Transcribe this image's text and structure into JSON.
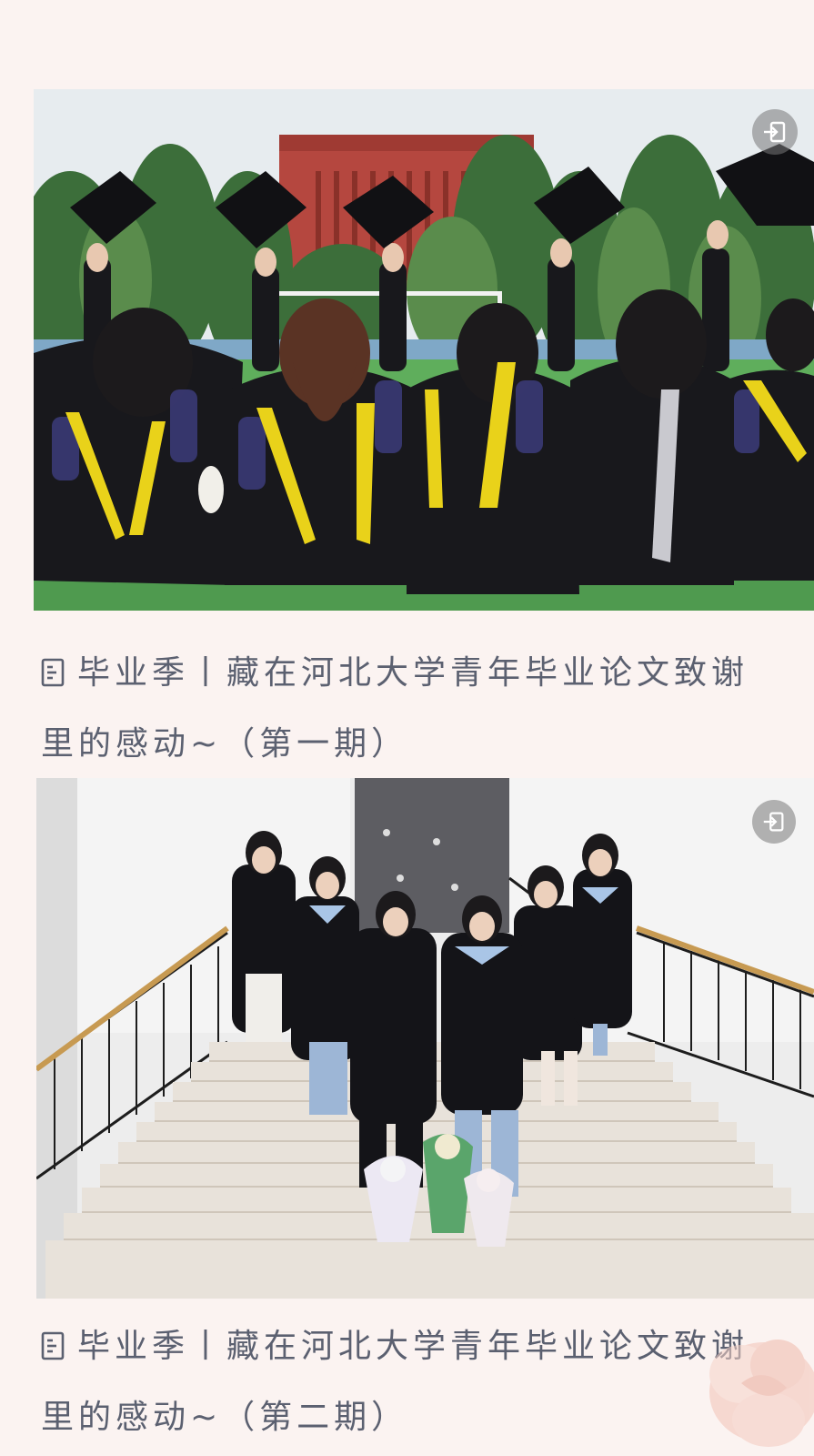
{
  "articles": [
    {
      "title_line1": "毕业季丨藏在河北大学青年毕业论文致谢",
      "title_line2": "里的感动~（第一期）",
      "image_icon": "share-icon",
      "doc_icon": "document-icon"
    },
    {
      "title_line1": "毕业季丨藏在河北大学青年毕业论文致谢",
      "title_line2": "里的感动~（第二期）",
      "image_icon": "share-icon",
      "doc_icon": "document-icon"
    }
  ],
  "colors": {
    "page_bg": "#fbf3f1",
    "title_text": "#5b6070",
    "gown": "#141418",
    "hood_yellow": "#e9d21a",
    "building_red": "#b5473f",
    "grass": "#4f9a4f",
    "sky": "#e7ecef",
    "stairs": "#e8e2da",
    "handrail": "#c79a52"
  }
}
